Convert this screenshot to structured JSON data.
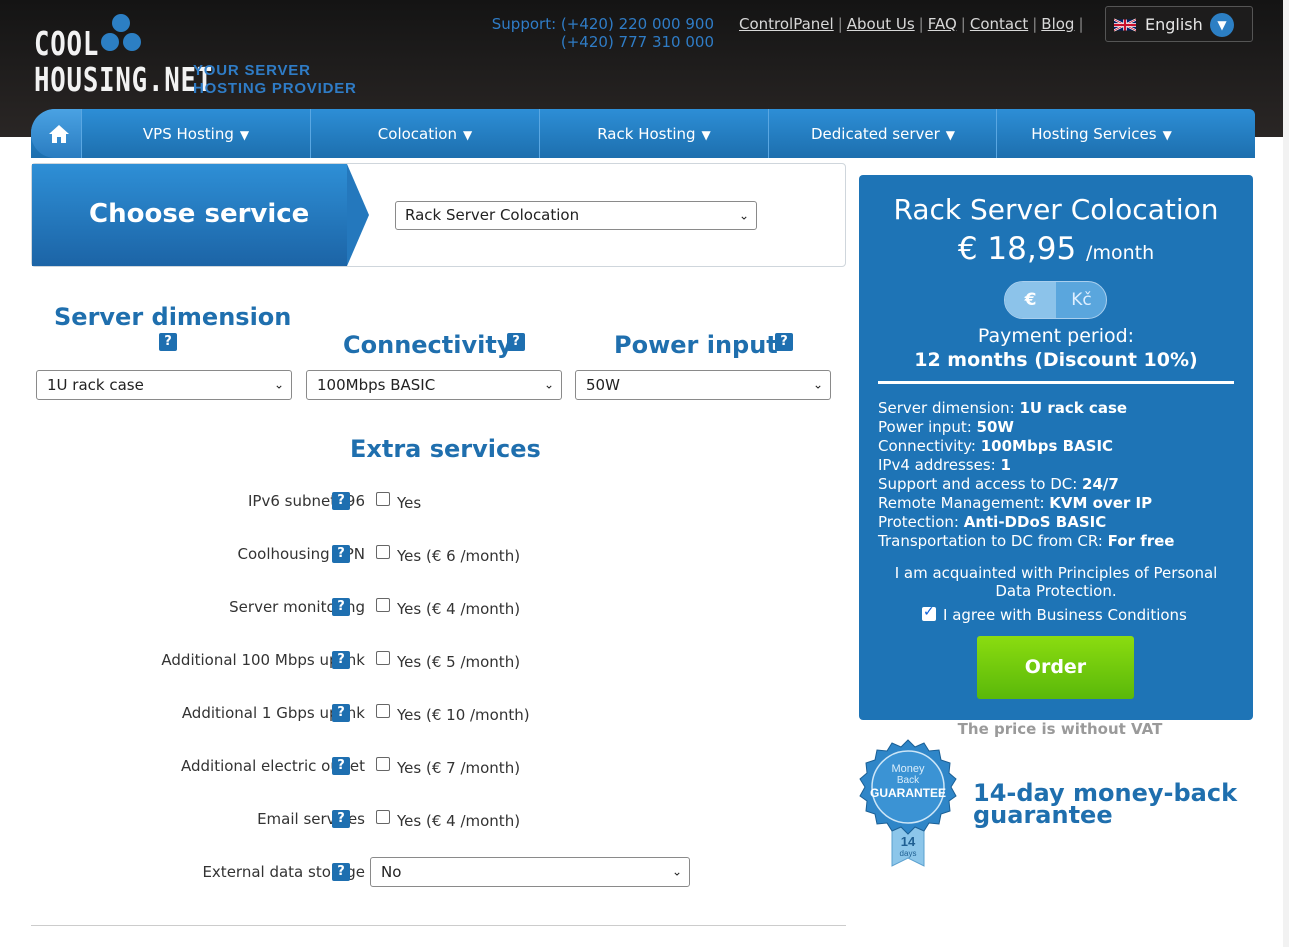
{
  "header": {
    "logo_line1": "COOL",
    "logo_line2": "HOUSING.NET",
    "tagline_line1": "YOUR SERVER",
    "tagline_line2": "HOSTING PROVIDER",
    "support_line1": "Support: (+420) 220 000 900",
    "support_line2": "(+420) 777 310 000",
    "links": [
      "ControlPanel",
      "About Us",
      "FAQ",
      "Contact",
      "Blog"
    ],
    "language": "English"
  },
  "nav": {
    "home_icon": "home-icon",
    "items": [
      "VPS Hosting",
      "Colocation",
      "Rack Hosting",
      "Dedicated server",
      "Hosting Services"
    ]
  },
  "choose": {
    "title": "Choose service",
    "selected": "Rack Server Colocation"
  },
  "config": {
    "server_dimension_title": "Server dimension",
    "server_dimension_value": "1U rack case",
    "connectivity_title": "Connectivity",
    "connectivity_value": "100Mbps BASIC",
    "power_title": "Power input",
    "power_value": "50W",
    "help_glyph": "?"
  },
  "extras": {
    "title": "Extra services",
    "rows": [
      {
        "label": "IPv6 subnet /96",
        "option": "Yes"
      },
      {
        "label": "Coolhousing VPN",
        "option": "Yes (€ 6 /month)"
      },
      {
        "label": "Server monitoring",
        "option": "Yes (€ 4 /month)"
      },
      {
        "label": "Additional 100 Mbps uplink",
        "option": "Yes (€ 5 /month)"
      },
      {
        "label": "Additional 1 Gbps uplink",
        "option": "Yes (€ 10 /month)"
      },
      {
        "label": "Additional electric outlet",
        "option": "Yes (€ 7 /month)"
      },
      {
        "label": "Email services",
        "option": "Yes (€ 4 /month)"
      }
    ],
    "storage_label": "External data storage",
    "storage_value": "No"
  },
  "summary": {
    "title": "Rack Server Colocation",
    "price": "€ 18,95",
    "per": "/month",
    "currency_eur": "€",
    "currency_czk": "Kč",
    "payment_label": "Payment period:",
    "payment_value": "12 months (Discount 10%)",
    "specs": [
      {
        "k": "Server dimension: ",
        "v": "1U rack case"
      },
      {
        "k": "Power input: ",
        "v": "50W"
      },
      {
        "k": "Connectivity: ",
        "v": "100Mbps BASIC"
      },
      {
        "k": "IPv4 addresses: ",
        "v": "1"
      },
      {
        "k": "Support and access to DC: ",
        "v": "24/7"
      },
      {
        "k": "Remote Management: ",
        "v": "KVM over IP"
      },
      {
        "k": "Protection: ",
        "v": "Anti-DDoS BASIC"
      },
      {
        "k": "Transportation to DC from CR: ",
        "v": "For free"
      }
    ],
    "privacy": "I am acquainted with Principles of Personal Data Protection.",
    "agree": "I agree with Business Conditions",
    "order": "Order",
    "vat": "The price is without VAT"
  },
  "guarantee": {
    "badge_line1": "Money",
    "badge_line2": "Back",
    "badge_line3": "GUARANTEE",
    "badge_days_num": "14",
    "badge_days_word": "days",
    "text_line1": "14-day money-back",
    "text_line2": "guarantee"
  },
  "colors": {
    "brand_blue": "#1e74b6",
    "order_green": "#6cc70c",
    "header_dark": "#1e1c1c"
  }
}
